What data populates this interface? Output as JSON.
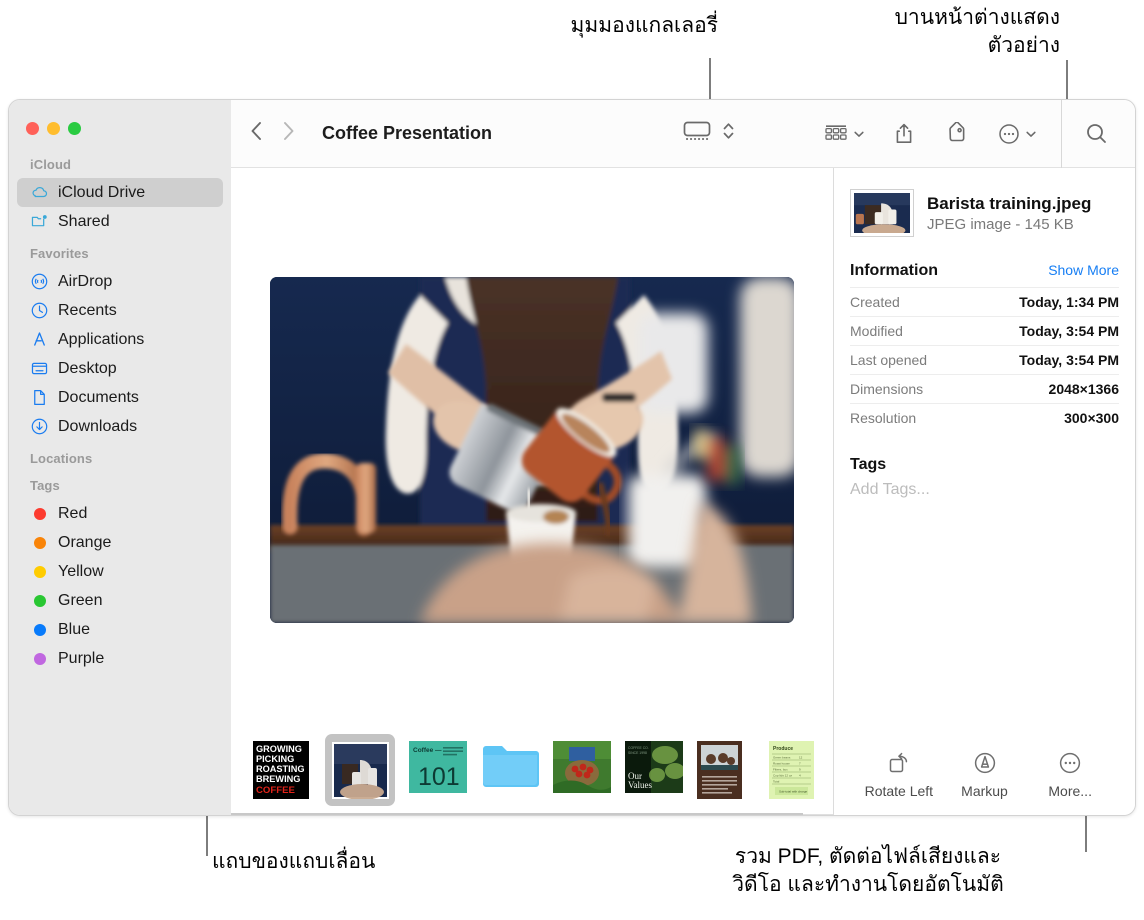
{
  "annotations": [
    {
      "id": "gallery-view",
      "text": "มุมมองแกลเลอรี่"
    },
    {
      "id": "preview-pane",
      "text": "บานหน้าต่างแสดง\nตัวอย่าง"
    },
    {
      "id": "scrubber-bar",
      "text": "แถบของแถบเลื่อน"
    },
    {
      "id": "more-actions",
      "text": "รวม PDF, ตัดต่อไฟล์เสียงและ\nวิดีโอ และทำงานโดยอัตโนมัติ"
    }
  ],
  "window": {
    "traffic_lights": [
      {
        "name": "close",
        "color": "#ff6159"
      },
      {
        "name": "minimize",
        "color": "#ffbd2e"
      },
      {
        "name": "zoom",
        "color": "#2acb42"
      }
    ]
  },
  "sidebar": {
    "groups": [
      {
        "header": "iCloud",
        "items": [
          {
            "label": "iCloud Drive",
            "icon": "cloud-icon",
            "selected": true
          },
          {
            "label": "Shared",
            "icon": "shared-folder-icon",
            "selected": false
          }
        ]
      },
      {
        "header": "Favorites",
        "items": [
          {
            "label": "AirDrop",
            "icon": "airdrop-icon",
            "selected": false
          },
          {
            "label": "Recents",
            "icon": "clock-icon",
            "selected": false
          },
          {
            "label": "Applications",
            "icon": "applications-icon",
            "selected": false
          },
          {
            "label": "Desktop",
            "icon": "desktop-icon",
            "selected": false
          },
          {
            "label": "Documents",
            "icon": "document-icon",
            "selected": false
          },
          {
            "label": "Downloads",
            "icon": "download-icon",
            "selected": false
          }
        ]
      },
      {
        "header": "Locations",
        "items": []
      },
      {
        "header": "Tags",
        "items": [
          {
            "label": "Red",
            "icon": "tag-dot",
            "color": "#fc3b2f",
            "selected": false
          },
          {
            "label": "Orange",
            "icon": "tag-dot",
            "color": "#f98408",
            "selected": false
          },
          {
            "label": "Yellow",
            "icon": "tag-dot",
            "color": "#ffcc00",
            "selected": false
          },
          {
            "label": "Green",
            "icon": "tag-dot",
            "color": "#29c732",
            "selected": false
          },
          {
            "label": "Blue",
            "icon": "tag-dot",
            "color": "#087bfb",
            "selected": false
          },
          {
            "label": "Purple",
            "icon": "tag-dot",
            "color": "#c067e0",
            "selected": false
          }
        ]
      }
    ]
  },
  "toolbar": {
    "back_icon": "chevron-left-icon",
    "forward_icon": "chevron-right-icon",
    "title": "Coffee Presentation",
    "view_gallery_icon": "gallery-view-icon",
    "view_stepper_icon": "up-down-chevron-icon",
    "group_icon": "group-items-icon",
    "group_chevron_icon": "chevron-down-icon",
    "share_icon": "share-icon",
    "tag_icon": "tag-icon",
    "more_icon": "ellipsis-circle-icon",
    "more_chevron_icon": "chevron-down-icon",
    "search_icon": "search-icon"
  },
  "preview": {
    "image_alt": "barista-pouring-coffee"
  },
  "filmstrip": {
    "items": [
      {
        "name": "growing-picking-roasting-brewing-coffee-poster",
        "selected": false
      },
      {
        "name": "barista-training-photo",
        "selected": true
      },
      {
        "name": "coffee-101-slide",
        "selected": false
      },
      {
        "name": "blue-folder",
        "selected": false
      },
      {
        "name": "coffee-cherries-photo",
        "selected": false
      },
      {
        "name": "our-values-slide",
        "selected": false
      },
      {
        "name": "team-meeting-document",
        "selected": false
      },
      {
        "name": "produce-spreadsheet",
        "selected": false
      }
    ]
  },
  "info_panel": {
    "file_name": "Barista training.jpeg",
    "file_kind": "JPEG image - 145 KB",
    "section_title": "Information",
    "show_more_label": "Show More",
    "rows": [
      {
        "key": "Created",
        "value": "Today, 1:34 PM"
      },
      {
        "key": "Modified",
        "value": "Today, 3:54 PM"
      },
      {
        "key": "Last opened",
        "value": "Today, 3:54 PM"
      },
      {
        "key": "Dimensions",
        "value": "2048×1366"
      },
      {
        "key": "Resolution",
        "value": "300×300"
      }
    ],
    "tags_title": "Tags",
    "tags_placeholder": "Add Tags...",
    "actions": [
      {
        "label": "Rotate Left",
        "icon": "rotate-left-icon"
      },
      {
        "label": "Markup",
        "icon": "markup-icon"
      },
      {
        "label": "More...",
        "icon": "ellipsis-circle-icon"
      }
    ]
  },
  "colors": {
    "accent_link": "#167ef4",
    "sidebar_bg": "#e9e9e9",
    "selection_bg": "#cfcfcf",
    "toolbar_bg": "#fcfcfc"
  }
}
